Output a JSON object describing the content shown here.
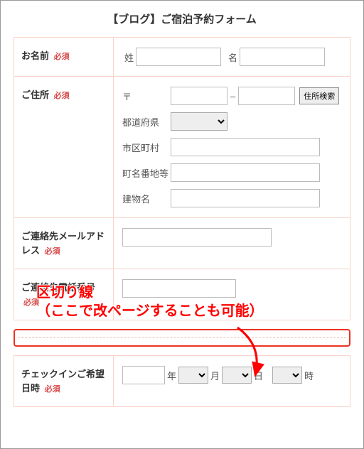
{
  "title": "【ブログ】ご宿泊予約フォーム",
  "requiredLabel": "必須",
  "rows": {
    "name": {
      "label": "お名前",
      "surnamePrefix": "姓",
      "givenPrefix": "名"
    },
    "address": {
      "label": "ご住所",
      "postalPrefix": "〒",
      "searchBtn": "住所検索",
      "pref": "都道府県",
      "city": "市区町村",
      "street": "町名番地等",
      "building": "建物名"
    },
    "email": {
      "label": "ご連絡先メールアドレス"
    },
    "phone": {
      "label": "ご連絡先電話番号"
    },
    "checkin": {
      "label": "チェックインご希望日時",
      "year": "年",
      "month": "月",
      "day": "日",
      "hour": "時"
    }
  },
  "annotation": {
    "line1": "区切り線",
    "line2": "（ここで改ページすることも可能）"
  }
}
